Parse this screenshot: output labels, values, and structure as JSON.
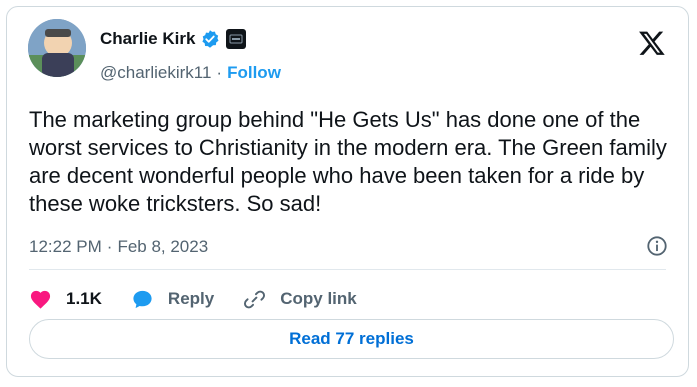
{
  "author": {
    "name": "Charlie Kirk",
    "handle": "@charliekirk11",
    "separator": "·",
    "follow_label": "Follow"
  },
  "tweet": {
    "text": "The marketing group behind \"He Gets Us\" has done one of the worst services to Christianity in the modern era. The Green family are decent wonderful people who have been taken for a ride by these woke tricksters. So sad!",
    "time": "12:22 PM",
    "separator": "·",
    "date": "Feb 8, 2023"
  },
  "actions": {
    "likes": "1.1K",
    "reply_label": "Reply",
    "copy_link_label": "Copy link"
  },
  "read_replies_label": "Read 77 replies",
  "icons": {
    "like": "heart-icon",
    "reply": "speech-bubble-icon",
    "copy": "link-icon",
    "info": "info-icon",
    "brand": "x-logo-icon"
  },
  "colors": {
    "accent": "#1d9bf0",
    "like": "#f91880",
    "text_secondary": "#536471"
  }
}
